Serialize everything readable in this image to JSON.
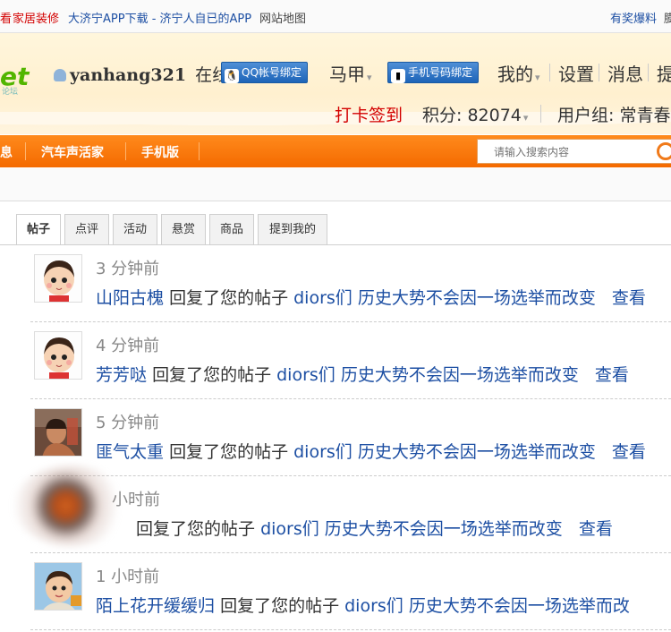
{
  "topbar": {
    "left_cut": "看",
    "home_decor": "家居装修",
    "app_download": "大济宁APP下载 - 济宁人自已的APP",
    "sitemap": "网站地图",
    "reward": "有奖爆料",
    "right_cut": "膨"
  },
  "header": {
    "logo": "et",
    "logo_sub": "论坛",
    "username": "yanhang321",
    "online": "在线",
    "qq_bind": "QQ帐号绑定",
    "majia": "马甲",
    "phone_bind": "手机号码绑定",
    "mine": "我的",
    "settings": "设置",
    "messages": "消息",
    "cut": "提",
    "checkin": "打卡签到",
    "points_label": "积分: 82074",
    "usergroup": "用户组: 常青",
    "usergroup_cut": "春"
  },
  "nav": {
    "cut_item": "息",
    "car": "汽车声活家",
    "mobile": "手机版"
  },
  "search": {
    "placeholder": "请输入搜索内容"
  },
  "tabs": [
    "帖子",
    "点评",
    "活动",
    "悬赏",
    "商品",
    "提到我的"
  ],
  "notifications": [
    {
      "time": "3 分钟前",
      "user": "山阳古槐",
      "action": "回复了您的帖子",
      "post": "diors们 历史大势不会因一场选举而改变",
      "view": "查看",
      "avatar": "cartoon-boy"
    },
    {
      "time": "4 分钟前",
      "user": "芳芳哒",
      "action": "回复了您的帖子",
      "post": "diors们 历史大势不会因一场选举而改变",
      "view": "查看",
      "avatar": "cartoon-boy"
    },
    {
      "time": "5 分钟前",
      "user": "匪气太重",
      "action": "回复了您的帖子",
      "post": "diors们 历史大势不会因一场选举而改变",
      "view": "查看",
      "avatar": "man-photo"
    },
    {
      "time": "小时前",
      "user": "",
      "action": "回复了您的帖子",
      "post": "diors们 历史大势不会因一场选举而改变",
      "view": "查看",
      "avatar": "blurred"
    },
    {
      "time": "1 小时前",
      "user": "陌上花开缓缓归",
      "action": "回复了您的帖子",
      "post": "diors们 历史大势不会因一场选举而改",
      "view": "",
      "avatar": "child-photo"
    }
  ]
}
